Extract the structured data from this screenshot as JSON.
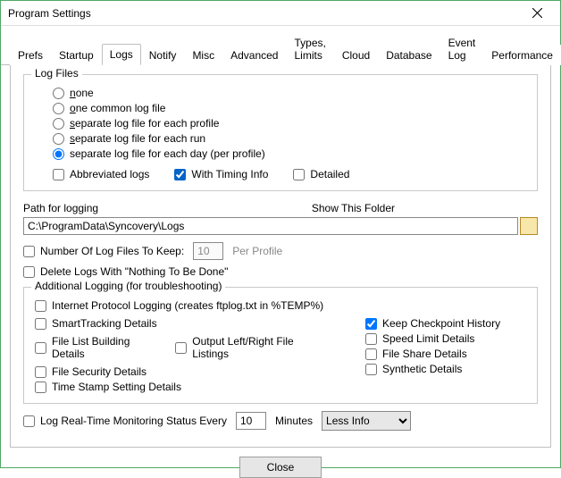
{
  "window": {
    "title": "Program Settings"
  },
  "tabs": {
    "items": [
      {
        "label": "Prefs"
      },
      {
        "label": "Startup"
      },
      {
        "label": "Logs"
      },
      {
        "label": "Notify"
      },
      {
        "label": "Misc"
      },
      {
        "label": "Advanced"
      },
      {
        "label": "Types, Limits"
      },
      {
        "label": "Cloud"
      },
      {
        "label": "Database"
      },
      {
        "label": "Event Log"
      },
      {
        "label": "Performance"
      }
    ],
    "active_index": 2
  },
  "log_files": {
    "legend": "Log Files",
    "radios": {
      "none_pre": "n",
      "none_post": "one",
      "one_pre": "o",
      "one_post": "ne common log file",
      "per_profile_pre": "s",
      "per_profile_post": "eparate log file for each profile",
      "per_run_pre": "s",
      "per_run_post": "eparate log file for each run",
      "per_day": "separate log file for each day (per profile)",
      "selected": "per_day"
    },
    "abbrev_label": "Abbreviated logs",
    "abbrev_checked": false,
    "timing_label": "With Timing Info",
    "timing_checked": true,
    "detailed_label": "Detailed",
    "detailed_checked": false
  },
  "path": {
    "label": "Path for logging",
    "show_folder": "Show This Folder",
    "value": "C:\\ProgramData\\Syncovery\\Logs"
  },
  "keep": {
    "label": "Number Of Log Files To Keep:",
    "value": "10",
    "suffix": "Per Profile",
    "checked": false
  },
  "delete_nothing": {
    "label": "Delete Logs With \"Nothing To Be Done\"",
    "checked": false
  },
  "additional": {
    "legend": "Additional Logging (for troubleshooting)",
    "ipl": {
      "label": "Internet Protocol Logging (creates ftplog.txt in %TEMP%)",
      "checked": false
    },
    "smart": {
      "label": "SmartTracking Details",
      "checked": false
    },
    "flb": {
      "label": "File List Building Details",
      "checked": false
    },
    "olr": {
      "label": "Output Left/Right File Listings",
      "checked": false
    },
    "fsec": {
      "label": "File Security Details",
      "checked": false
    },
    "tss": {
      "label": "Time Stamp Setting Details",
      "checked": false
    },
    "kch": {
      "label": "Keep Checkpoint History",
      "checked": true
    },
    "sld": {
      "label": "Speed Limit Details",
      "checked": false
    },
    "fsh": {
      "label": "File Share Details",
      "checked": false
    },
    "syn": {
      "label": "Synthetic Details",
      "checked": false
    }
  },
  "realtime": {
    "label": "Log Real-Time Monitoring Status Every",
    "value": "10",
    "unit": "Minutes",
    "select": "Less Info",
    "checked": false
  },
  "buttons": {
    "close": "Close"
  }
}
